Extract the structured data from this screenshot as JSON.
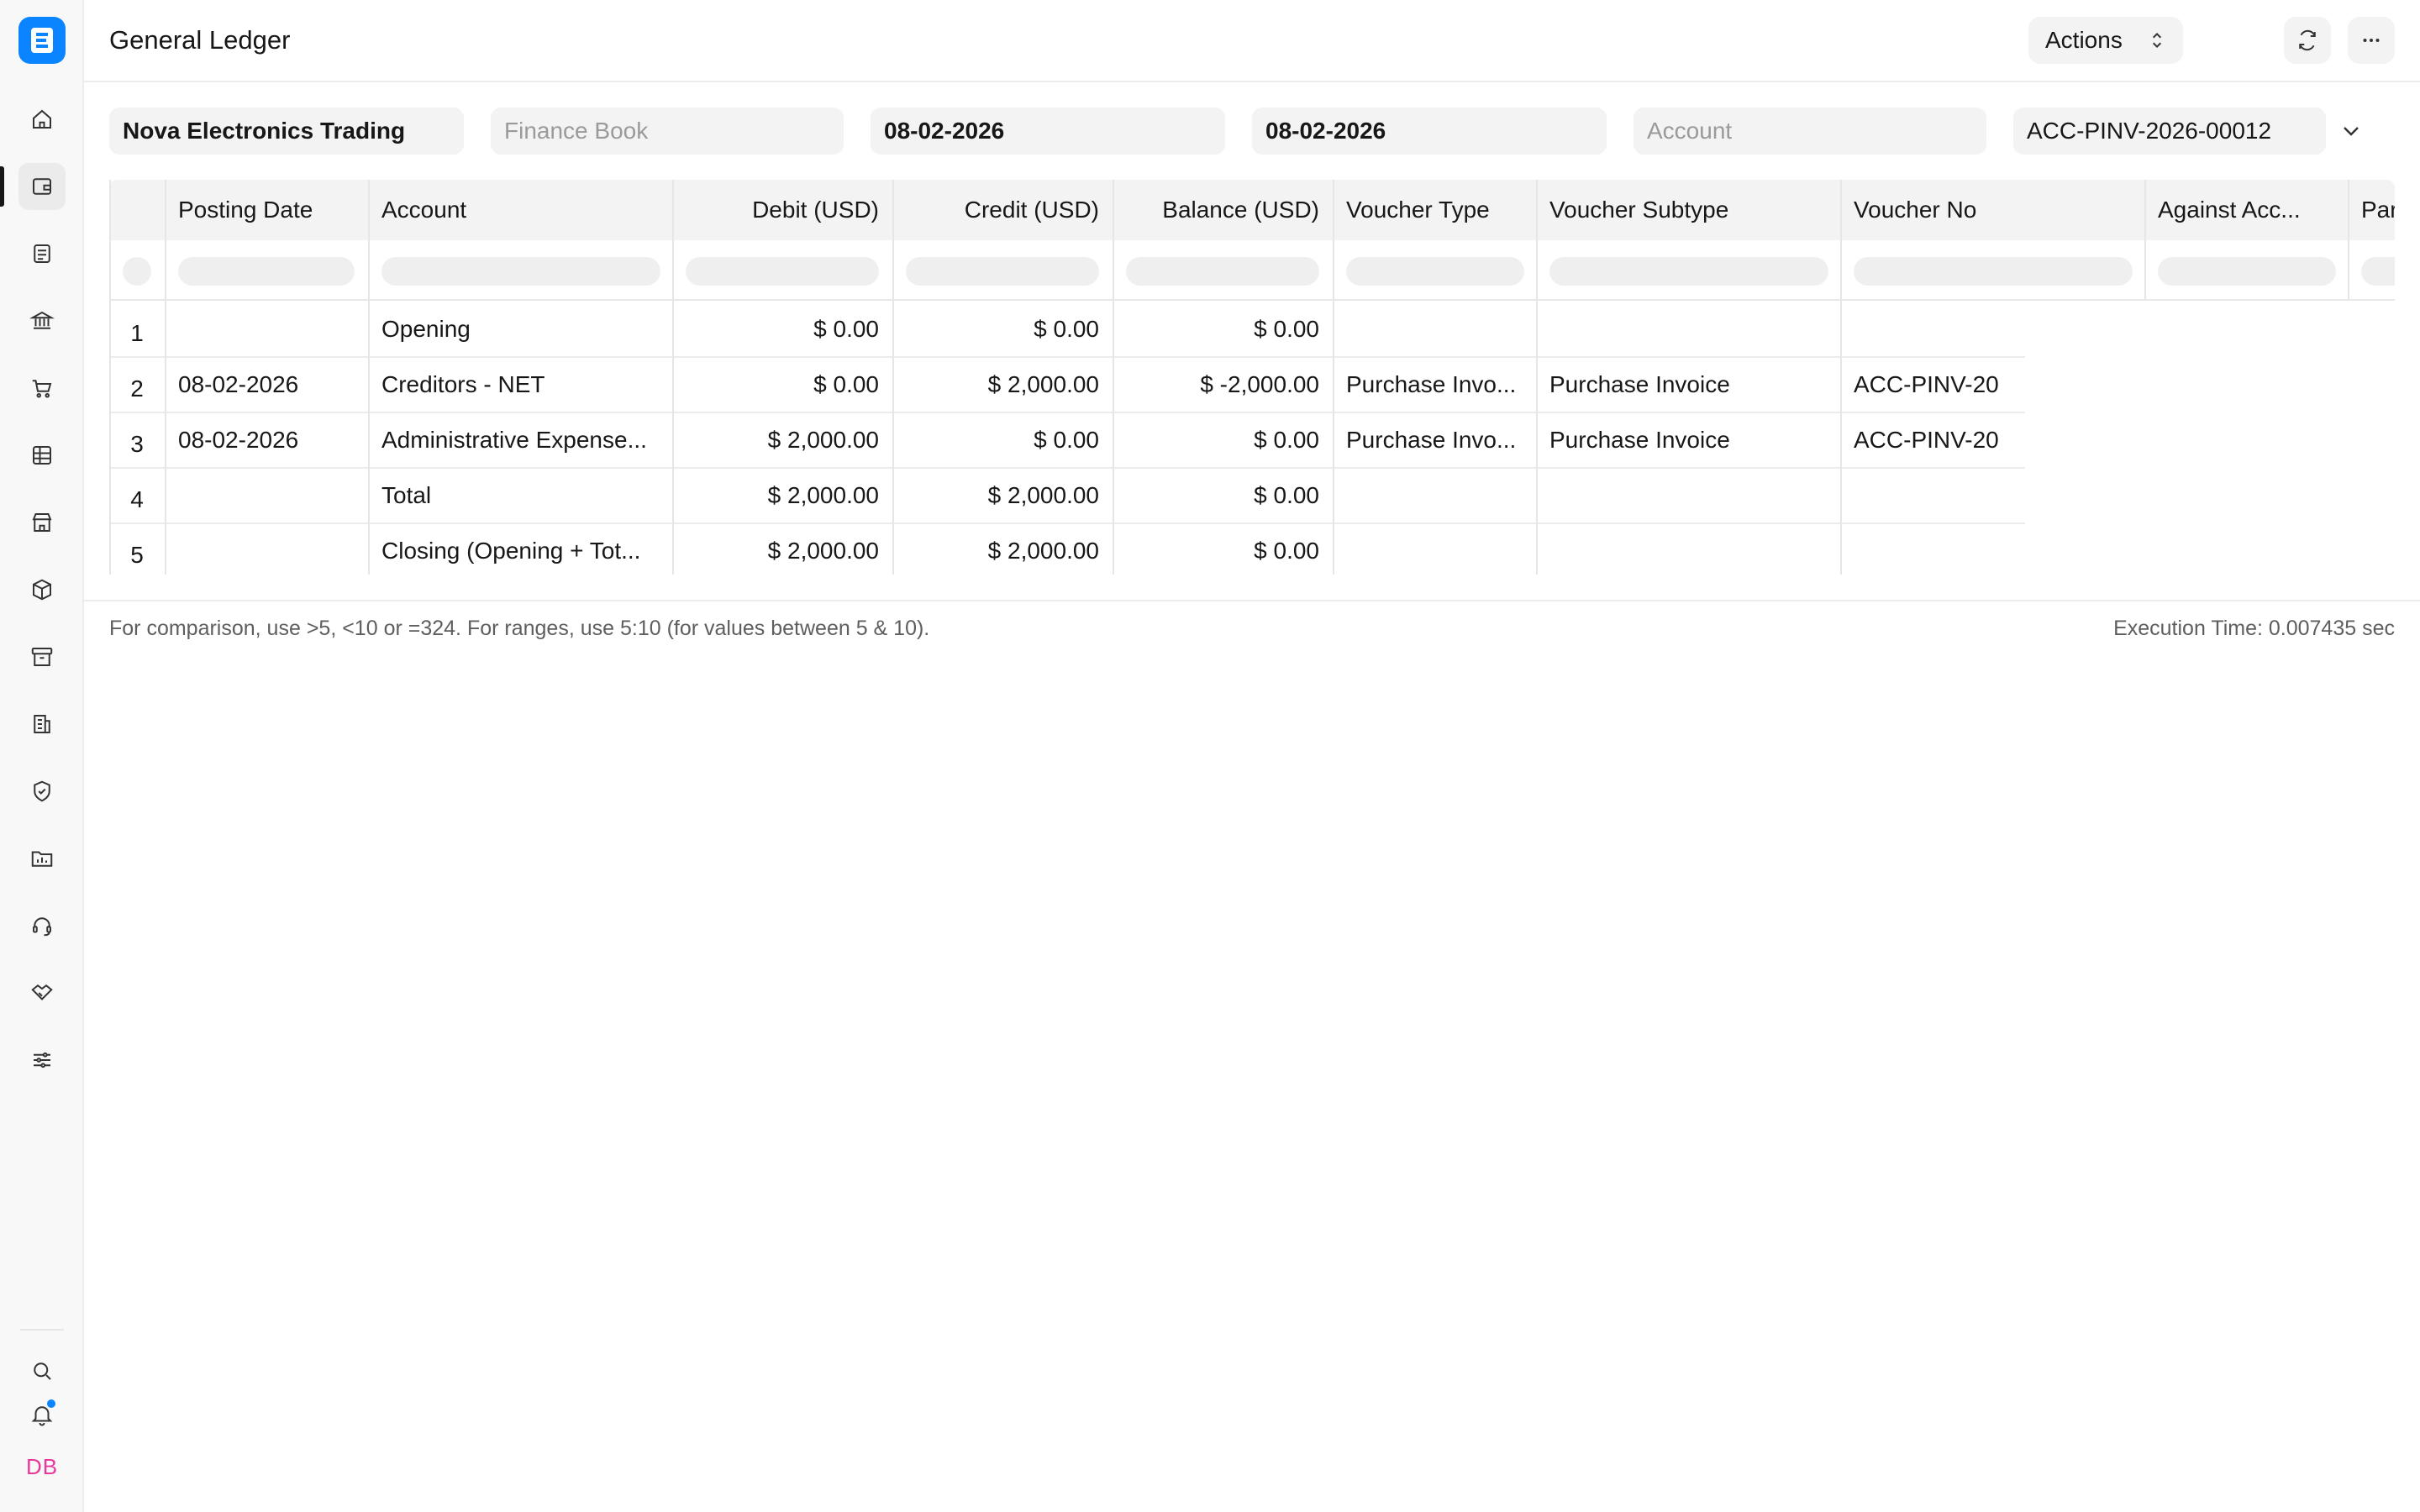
{
  "app": {
    "title": "General Ledger",
    "actions_label": "Actions",
    "avatar_initials": "DB"
  },
  "sidebar": {
    "items": [
      {
        "icon": "home-icon"
      },
      {
        "icon": "accounting-wallet-icon",
        "active": true
      },
      {
        "icon": "document-list-icon"
      },
      {
        "icon": "bank-icon"
      },
      {
        "icon": "shopping-cart-icon"
      },
      {
        "icon": "table-grid-icon"
      },
      {
        "icon": "storefront-icon"
      },
      {
        "icon": "package-icon"
      },
      {
        "icon": "archive-box-icon"
      },
      {
        "icon": "building-icon"
      },
      {
        "icon": "shield-check-icon"
      },
      {
        "icon": "folder-chart-icon"
      },
      {
        "icon": "headset-icon"
      },
      {
        "icon": "handshake-icon"
      },
      {
        "icon": "sliders-icon"
      }
    ],
    "bottom": [
      {
        "icon": "search-icon"
      },
      {
        "icon": "bell-icon"
      }
    ]
  },
  "filters": {
    "company": "Nova Electronics Trading",
    "finance_book_placeholder": "Finance Book",
    "from_date": "08-02-2026",
    "to_date": "08-02-2026",
    "account_placeholder": "Account",
    "voucher_no": "ACC-PINV-2026-00012"
  },
  "table": {
    "columns": [
      "Posting Date",
      "Account",
      "Debit (USD)",
      "Credit (USD)",
      "Balance (USD)",
      "Voucher Type",
      "Voucher Subtype",
      "Voucher No",
      "Against Acc...",
      "Par"
    ],
    "rows": [
      {
        "n": "1",
        "posting_date": "",
        "account": "Opening",
        "debit": "$ 0.00",
        "credit": "$ 0.00",
        "balance": "$ 0.00",
        "voucher_type": "",
        "voucher_subtype": "",
        "voucher_no": ""
      },
      {
        "n": "2",
        "posting_date": "08-02-2026",
        "account": "Creditors - NET",
        "debit": "$ 0.00",
        "credit": "$ 2,000.00",
        "balance": "$ -2,000.00",
        "voucher_type": "Purchase Invo...",
        "voucher_subtype": "Purchase Invoice",
        "voucher_no": "ACC-PINV-20"
      },
      {
        "n": "3",
        "posting_date": "08-02-2026",
        "account": "Administrative Expense...",
        "debit": "$ 2,000.00",
        "credit": "$ 0.00",
        "balance": "$ 0.00",
        "voucher_type": "Purchase Invo...",
        "voucher_subtype": "Purchase Invoice",
        "voucher_no": "ACC-PINV-20"
      },
      {
        "n": "4",
        "posting_date": "",
        "account": "Total",
        "debit": "$ 2,000.00",
        "credit": "$ 2,000.00",
        "balance": "$ 0.00",
        "voucher_type": "",
        "voucher_subtype": "",
        "voucher_no": ""
      },
      {
        "n": "5",
        "posting_date": "",
        "account": "Closing (Opening + Tot...",
        "debit": "$ 2,000.00",
        "credit": "$ 2,000.00",
        "balance": "$ 0.00",
        "voucher_type": "",
        "voucher_subtype": "",
        "voucher_no": ""
      }
    ]
  },
  "footer": {
    "help": "For comparison, use >5, <10 or =324. For ranges, use 5:10 (for values between 5 & 10).",
    "execution_time": "Execution Time: 0.007435 sec"
  },
  "colors": {
    "accent": "#0a84ff",
    "avatar": "#e6399b"
  }
}
